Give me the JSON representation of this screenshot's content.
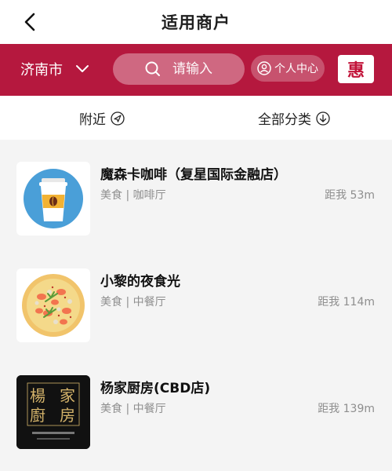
{
  "header": {
    "title": "适用商户",
    "back_icon": "chevron-left-icon"
  },
  "searchbar": {
    "background": "#b5183e",
    "city": "济南市",
    "search_placeholder": "请输入",
    "personal_center": "个人中心",
    "hui_badge": "惠"
  },
  "filters": {
    "nearby": "附近",
    "all_categories": "全部分类"
  },
  "merchants": [
    {
      "name": "魔森卡咖啡（复星国际金融店）",
      "category": "美食 | 咖啡厅",
      "distance": "距我 53m",
      "thumb_icon": "coffee-cup-icon"
    },
    {
      "name": "小黎的夜食光",
      "category": "美食 | 中餐厅",
      "distance": "距我 114m",
      "thumb_icon": "pizza-icon"
    },
    {
      "name": "杨家厨房(CBD店)",
      "category": "美食 | 中餐厅",
      "distance": "距我 139m",
      "thumb_icon": "restaurant-logo-icon",
      "logo_text": "楊家廚房"
    }
  ]
}
